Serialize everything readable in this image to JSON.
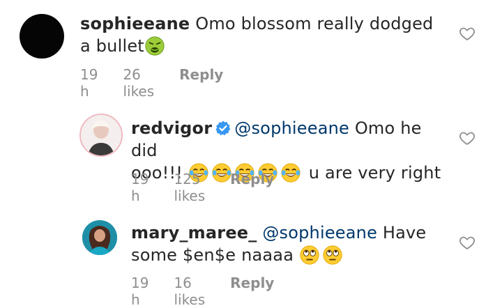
{
  "comments": [
    {
      "username": "sophieeane",
      "text": "Omo blossom really dodged a bullet",
      "emoji": [
        "nauseated-face"
      ],
      "time": "19 h",
      "likes": "26 likes",
      "reply": "Reply"
    },
    {
      "username": "redvigor",
      "verified": true,
      "mention": "@sophieeane",
      "text_line1": " Omo he did",
      "text_line2_pre": "ooo!!! ",
      "text_line2_post": " u are very right",
      "emoji": [
        "tears-of-joy",
        "tears-of-joy",
        "tears-of-joy",
        "tears-of-joy",
        "tears-of-joy"
      ],
      "time": "19 h",
      "likes": "125 likes",
      "reply": "Reply"
    },
    {
      "username": "mary_maree_",
      "mention": "@sophieeane",
      "text_line1": " Have",
      "text_line2_pre": "some $en$e naaaa ",
      "emoji": [
        "rolling-eyes",
        "rolling-eyes"
      ],
      "time": "19 h",
      "likes": "16 likes",
      "reply": "Reply"
    }
  ],
  "colors": {
    "text": "#262626",
    "muted": "#8e8e8e",
    "mention": "#00376b",
    "verified": "#3897f0"
  }
}
